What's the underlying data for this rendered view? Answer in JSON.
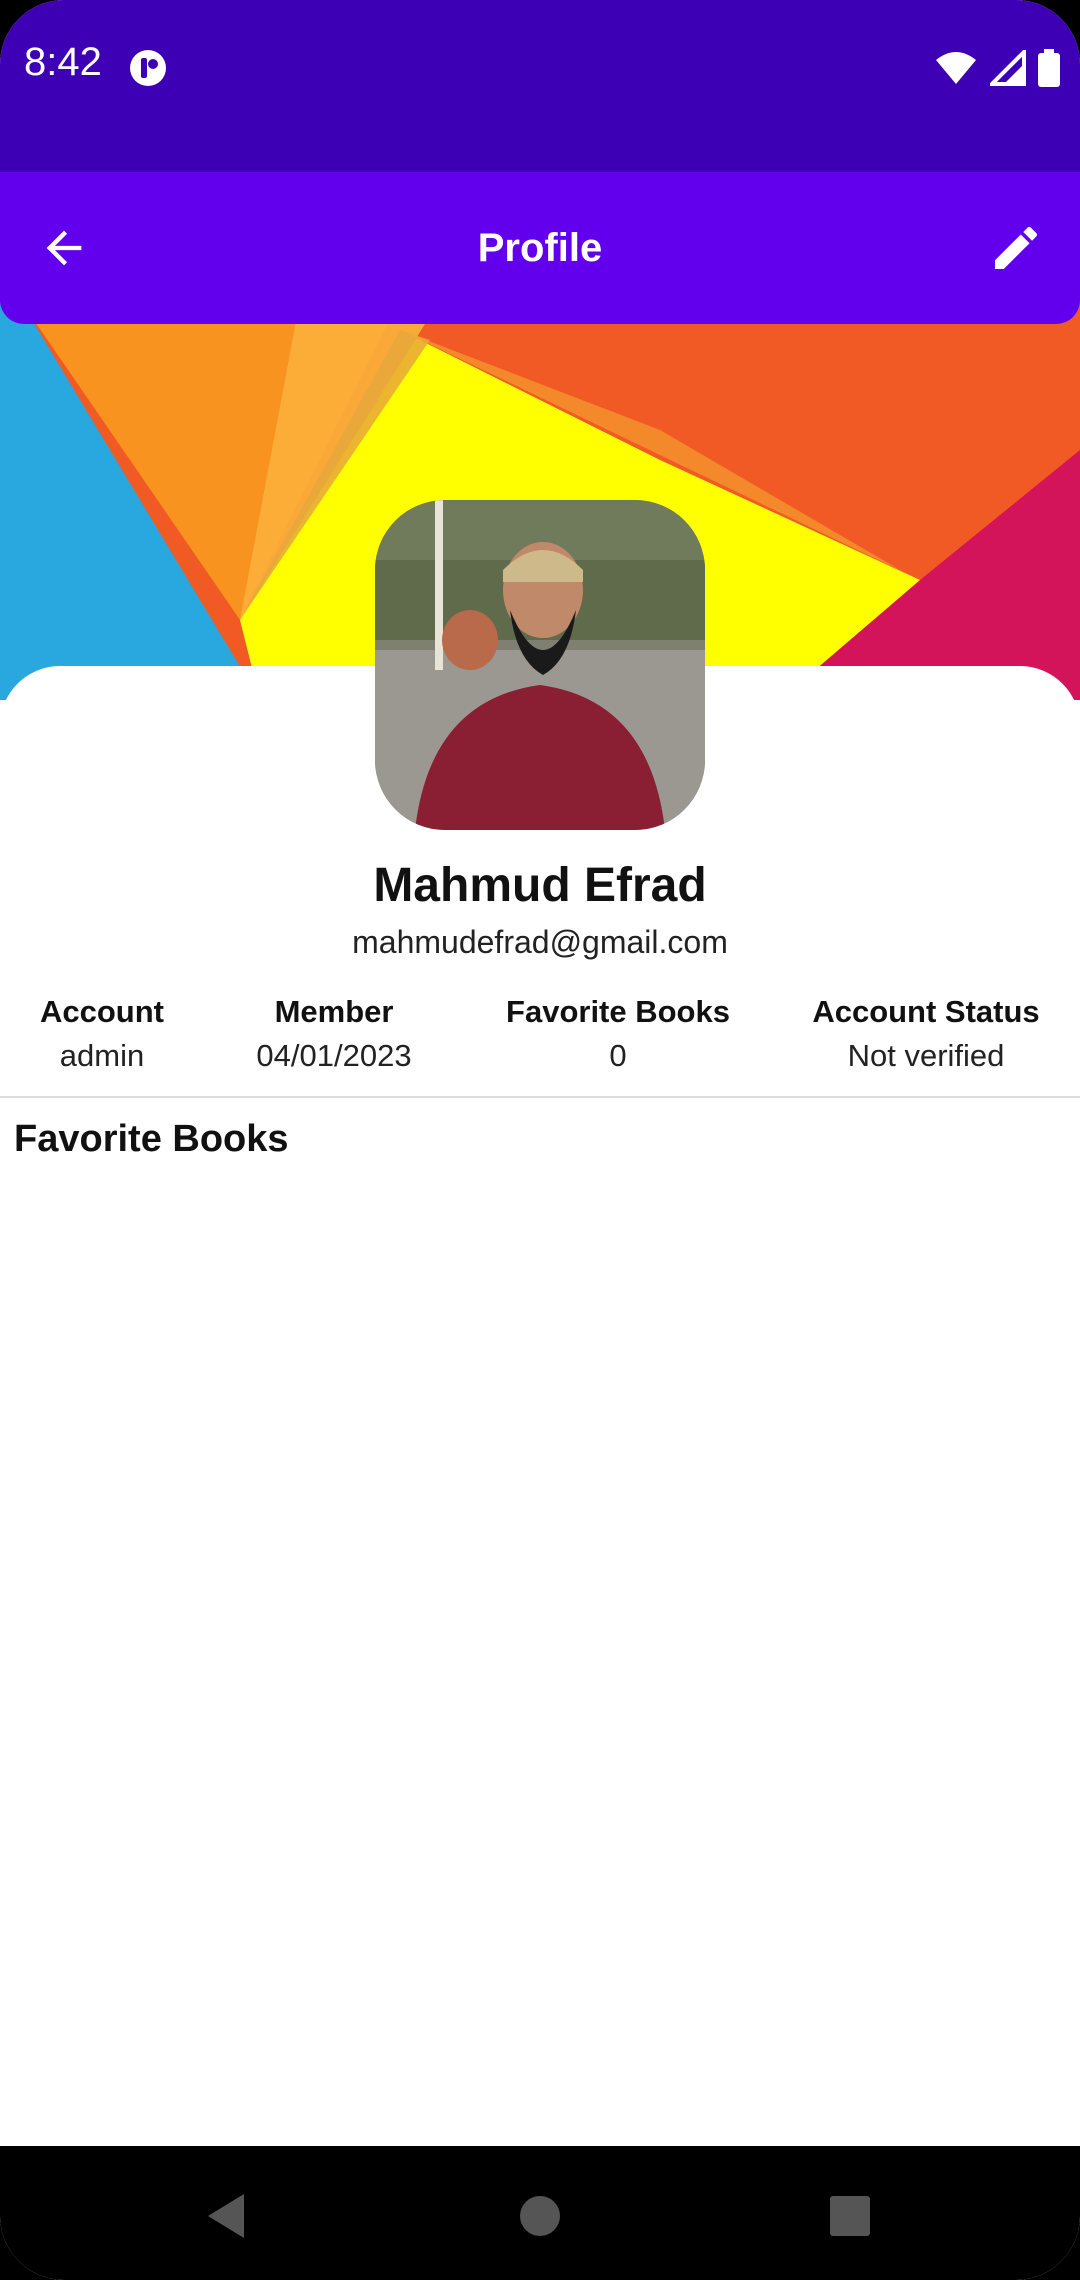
{
  "status_bar": {
    "time": "8:42"
  },
  "app_bar": {
    "title": "Profile",
    "back_icon": "arrow-back-icon",
    "edit_icon": "pencil-icon"
  },
  "profile": {
    "name": "Mahmud Efrad",
    "email": "mahmudefrad@gmail.com"
  },
  "stats": [
    {
      "label": "Account",
      "value": "admin"
    },
    {
      "label": "Member",
      "value": "04/01/2023"
    },
    {
      "label": "Favorite Books",
      "value": "0"
    },
    {
      "label": "Account Status",
      "value": "Not verified"
    }
  ],
  "favorites": {
    "title": "Favorite Books"
  },
  "colors": {
    "status_bar": "#3e00b4",
    "app_bar": "#6200ee",
    "cover_blue": "#29a8e0",
    "cover_orange": "#f7931e",
    "cover_red_orange": "#f15a24",
    "cover_yellow": "#ffff00",
    "cover_magenta": "#d4145a"
  }
}
